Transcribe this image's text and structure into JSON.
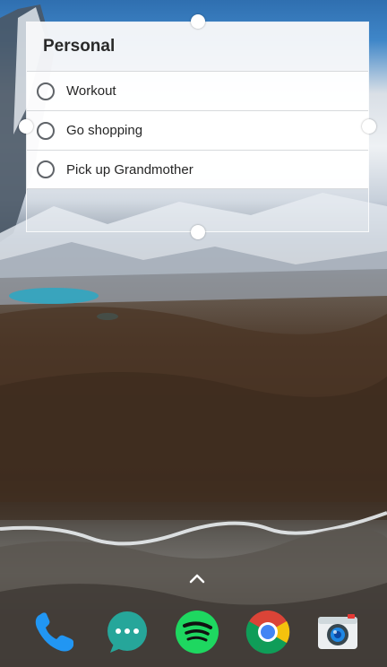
{
  "widget": {
    "title": "Personal",
    "tasks": [
      {
        "label": "Workout",
        "done": false
      },
      {
        "label": "Go shopping",
        "done": false
      },
      {
        "label": "Pick up Grandmother",
        "done": false
      }
    ]
  },
  "dock": {
    "apps": [
      {
        "name": "Phone",
        "icon": "phone-icon"
      },
      {
        "name": "Messages",
        "icon": "messages-icon"
      },
      {
        "name": "Spotify",
        "icon": "spotify-icon"
      },
      {
        "name": "Chrome",
        "icon": "chrome-icon"
      },
      {
        "name": "Camera",
        "icon": "camera-icon"
      }
    ],
    "app_drawer_icon": "chevron-up-icon"
  },
  "colors": {
    "phone": "#2196f3",
    "messages": "#26a69a",
    "spotify": "#1ed760",
    "chrome_red": "#db4437",
    "chrome_yellow": "#f4c20d",
    "chrome_green": "#0f9d58",
    "chrome_blue": "#4285f4"
  }
}
